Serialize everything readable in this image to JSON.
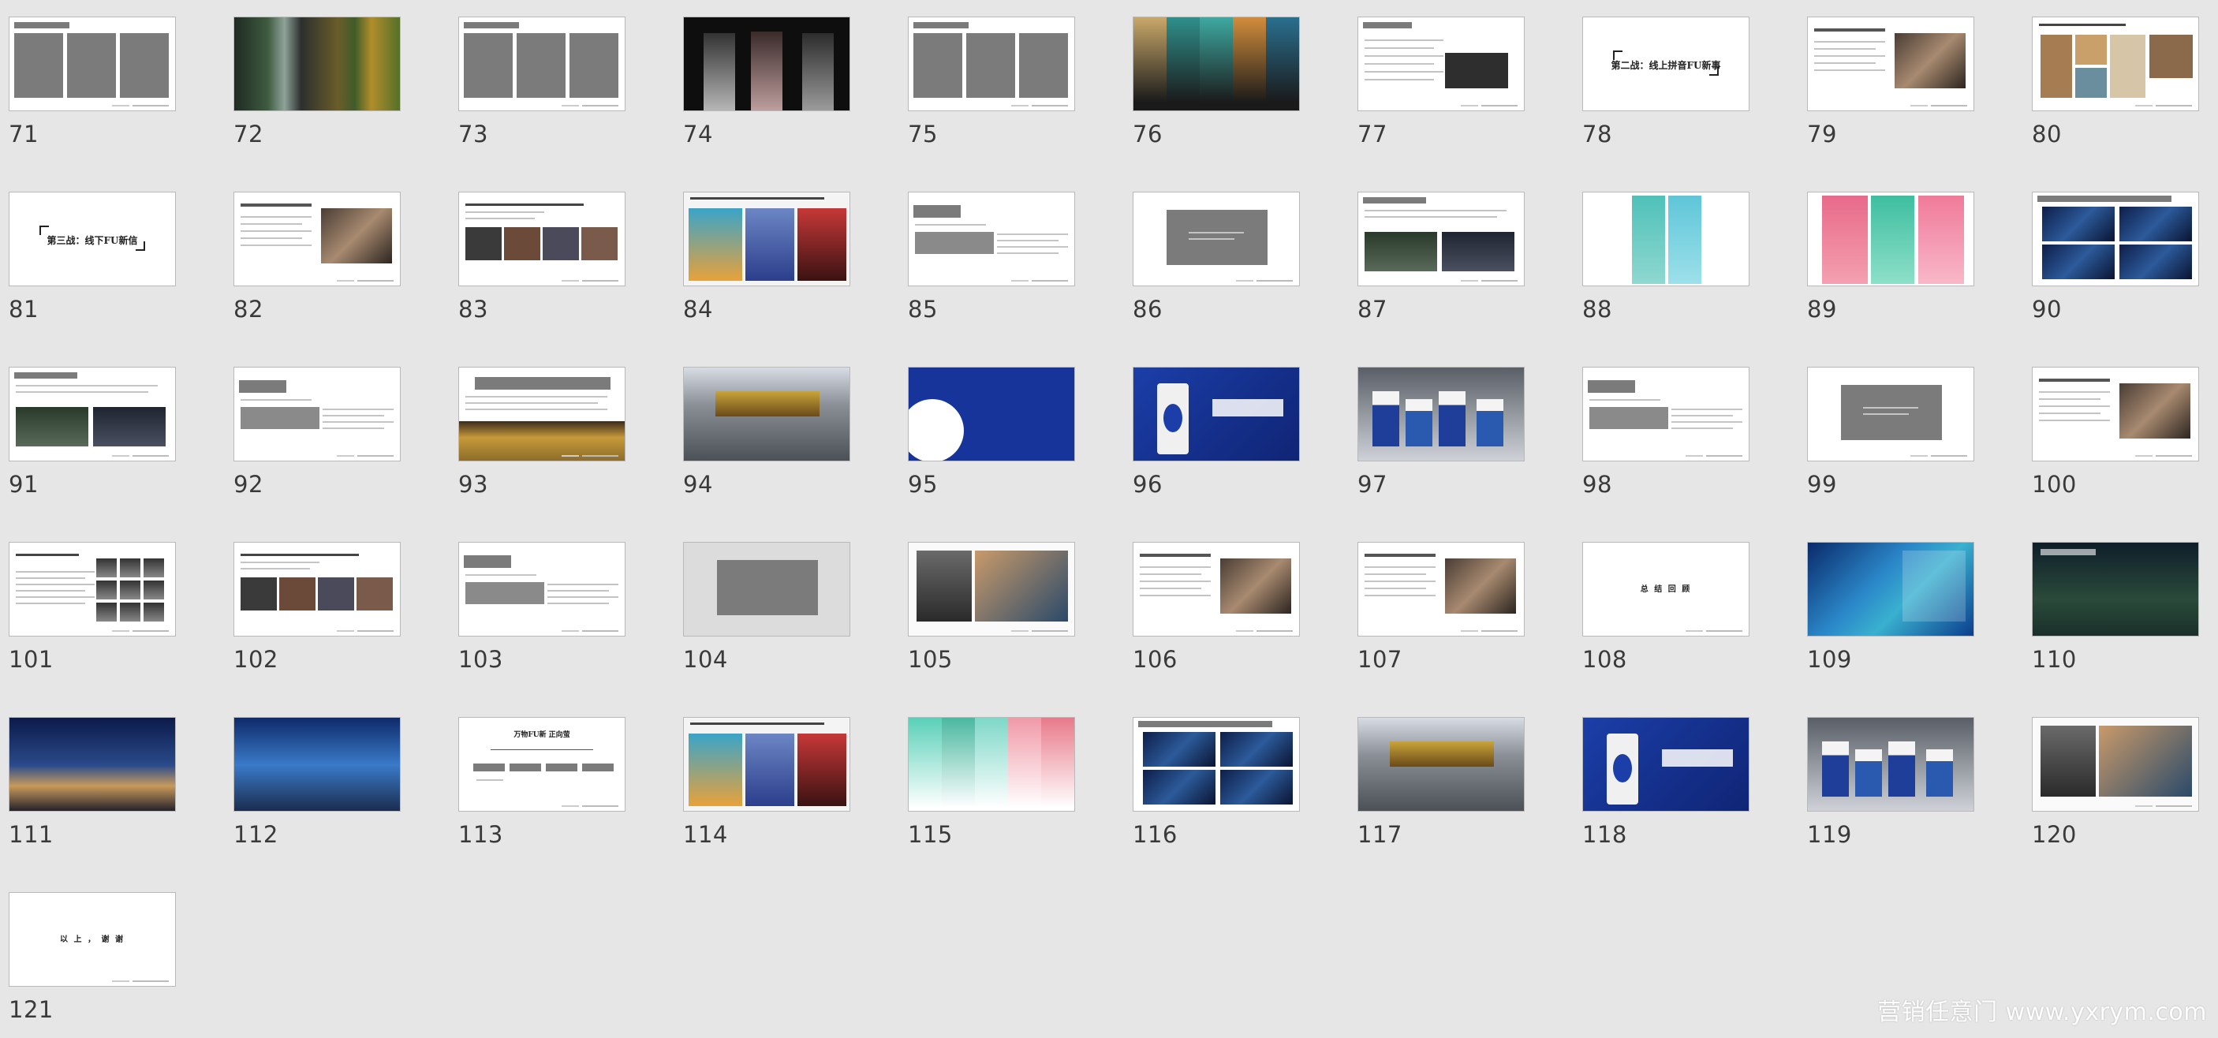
{
  "slides": [
    {
      "n": "71",
      "kind": "three-gray"
    },
    {
      "n": "72",
      "kind": "photo-forest"
    },
    {
      "n": "73",
      "kind": "three-gray"
    },
    {
      "n": "74",
      "kind": "photo-dark-people"
    },
    {
      "n": "75",
      "kind": "three-gray"
    },
    {
      "n": "76",
      "kind": "photo-colorful-panels"
    },
    {
      "n": "77",
      "kind": "text-darkbox"
    },
    {
      "n": "78",
      "kind": "bracket-title",
      "title": "第二战：线上拼音FU新事"
    },
    {
      "n": "79",
      "kind": "text-photo"
    },
    {
      "n": "80",
      "kind": "text-photo-grid"
    },
    {
      "n": "81",
      "kind": "bracket-title",
      "title": "第三战：线下FU新信"
    },
    {
      "n": "82",
      "kind": "text-photo"
    },
    {
      "n": "83",
      "kind": "text-photostrip"
    },
    {
      "n": "84",
      "kind": "photo-collage"
    },
    {
      "n": "85",
      "kind": "text-boxes"
    },
    {
      "n": "86",
      "kind": "gray-center"
    },
    {
      "n": "87",
      "kind": "text-photos"
    },
    {
      "n": "88",
      "kind": "teal-posters"
    },
    {
      "n": "89",
      "kind": "pink-teal-posters"
    },
    {
      "n": "90",
      "kind": "navy-billboards"
    },
    {
      "n": "91",
      "kind": "text-photos"
    },
    {
      "n": "92",
      "kind": "text-boxes"
    },
    {
      "n": "93",
      "kind": "banner-photo"
    },
    {
      "n": "94",
      "kind": "photo-street"
    },
    {
      "n": "95",
      "kind": "blue-logo"
    },
    {
      "n": "96",
      "kind": "blue-cup"
    },
    {
      "n": "97",
      "kind": "cups"
    },
    {
      "n": "98",
      "kind": "text-boxes"
    },
    {
      "n": "99",
      "kind": "gray-center"
    },
    {
      "n": "100",
      "kind": "text-photo"
    },
    {
      "n": "101",
      "kind": "text-people"
    },
    {
      "n": "102",
      "kind": "text-photostrip"
    },
    {
      "n": "103",
      "kind": "text-boxes"
    },
    {
      "n": "104",
      "kind": "gray-full"
    },
    {
      "n": "105",
      "kind": "photo-people"
    },
    {
      "n": "106",
      "kind": "text-photo"
    },
    {
      "n": "107",
      "kind": "text-photo"
    },
    {
      "n": "108",
      "kind": "center-small",
      "title": "总 结 回 顾"
    },
    {
      "n": "109",
      "kind": "new-banner"
    },
    {
      "n": "110",
      "kind": "new-dark"
    },
    {
      "n": "111",
      "kind": "city-night"
    },
    {
      "n": "112",
      "kind": "city-blue"
    },
    {
      "n": "113",
      "kind": "org-chart",
      "title": "万物FU新 正向萤"
    },
    {
      "n": "114",
      "kind": "photo-collage"
    },
    {
      "n": "115",
      "kind": "pastel-posters"
    },
    {
      "n": "116",
      "kind": "navy-billboards"
    },
    {
      "n": "117",
      "kind": "photo-street"
    },
    {
      "n": "118",
      "kind": "blue-cup"
    },
    {
      "n": "119",
      "kind": "cups"
    },
    {
      "n": "120",
      "kind": "photo-people"
    },
    {
      "n": "121",
      "kind": "center-small",
      "title": "以 上 ， 谢 谢"
    }
  ],
  "watermark": "营销任意门 www.yxrym.com"
}
